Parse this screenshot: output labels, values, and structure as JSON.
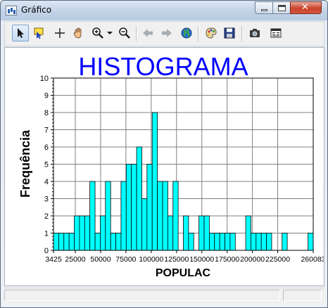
{
  "window": {
    "title": "Gráfico",
    "close_glyph": "✕"
  },
  "toolbar": {
    "items": [
      {
        "name": "select-arrow-icon",
        "tooltip": "Select"
      },
      {
        "name": "select-info-icon",
        "tooltip": "Identify"
      },
      {
        "name": "crosshair-icon",
        "tooltip": "Crosshair"
      },
      {
        "name": "pan-hand-icon",
        "tooltip": "Pan"
      },
      {
        "name": "zoom-in-icon",
        "tooltip": "Zoom in"
      },
      {
        "name": "zoom-dropdown-arrow-icon",
        "tooltip": "Zoom options"
      },
      {
        "name": "zoom-out-icon",
        "tooltip": "Zoom out"
      },
      {
        "name": "back-arrow-icon",
        "tooltip": "Back"
      },
      {
        "name": "forward-arrow-icon",
        "tooltip": "Forward"
      },
      {
        "name": "globe-icon",
        "tooltip": "Full extent"
      },
      {
        "name": "palette-icon",
        "tooltip": "Colors"
      },
      {
        "name": "save-disk-icon",
        "tooltip": "Save"
      },
      {
        "name": "camera-icon",
        "tooltip": "Snapshot"
      },
      {
        "name": "window-properties-icon",
        "tooltip": "Properties"
      }
    ]
  },
  "colors": {
    "bar_fill": "#00ffff",
    "title_color": "#0000ff",
    "grid": "#808080"
  },
  "chart_data": {
    "type": "bar",
    "title": "HISTOGRAMA",
    "xlabel": "POPULAC",
    "ylabel": "Frequência",
    "ylim": [
      0,
      10
    ],
    "xlim": [
      3425,
      260083
    ],
    "grid": true,
    "y_ticks": [
      "0",
      "1",
      "2",
      "3",
      "4",
      "5",
      "6",
      "7",
      "8",
      "9",
      "10"
    ],
    "x_tick_labels": [
      {
        "value": 3425,
        "label": "3425"
      },
      {
        "value": 25000,
        "label": "25000"
      },
      {
        "value": 50000,
        "label": "50000"
      },
      {
        "value": 75000,
        "label": "75000"
      },
      {
        "value": 100000,
        "label": "100000"
      },
      {
        "value": 125000,
        "label": "125000"
      },
      {
        "value": 150000,
        "label": "150000"
      },
      {
        "value": 175000,
        "label": "175000"
      },
      {
        "value": 200000,
        "label": "200000"
      },
      {
        "value": 225000,
        "label": "225000"
      },
      {
        "value": 260083,
        "label": "260083"
      }
    ],
    "bin_start": 3425,
    "bin_width": 5133.16,
    "values": [
      1,
      1,
      1,
      1,
      2,
      2,
      2,
      4,
      1,
      2,
      4,
      1,
      1,
      4,
      5,
      5,
      6,
      3,
      5,
      8,
      4,
      4,
      2,
      4,
      0,
      2,
      1,
      0,
      2,
      2,
      1,
      1,
      1,
      1,
      1,
      0,
      0,
      2,
      1,
      1,
      1,
      1,
      0,
      0,
      1,
      0,
      0,
      0,
      0,
      1
    ]
  }
}
